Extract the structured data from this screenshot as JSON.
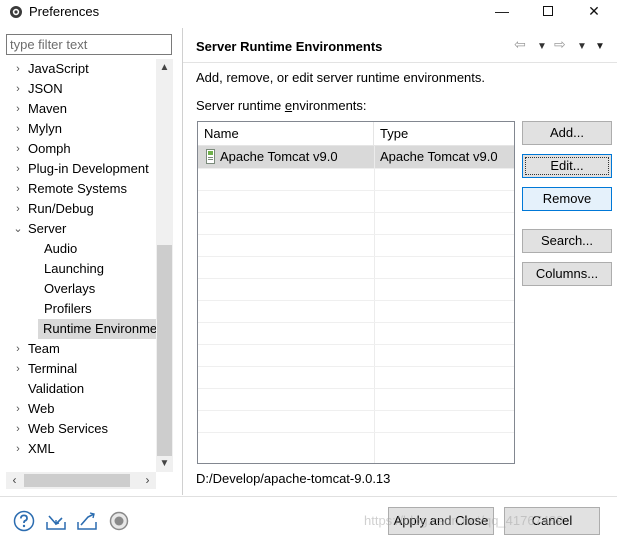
{
  "window": {
    "title": "Preferences",
    "controls": {
      "minimize": "—",
      "close": "✕"
    }
  },
  "sidebar": {
    "filter_placeholder": "type filter text",
    "items": [
      {
        "label": "JavaScript",
        "twisty": "›"
      },
      {
        "label": "JSON",
        "twisty": "›"
      },
      {
        "label": "Maven",
        "twisty": "›"
      },
      {
        "label": "Mylyn",
        "twisty": "›"
      },
      {
        "label": "Oomph",
        "twisty": "›"
      },
      {
        "label": "Plug-in Development",
        "twisty": "›"
      },
      {
        "label": "Remote Systems",
        "twisty": "›"
      },
      {
        "label": "Run/Debug",
        "twisty": "›"
      },
      {
        "label": "Server",
        "twisty": "⌄"
      },
      {
        "label": "Audio",
        "twisty": ""
      },
      {
        "label": "Launching",
        "twisty": ""
      },
      {
        "label": "Overlays",
        "twisty": ""
      },
      {
        "label": "Profilers",
        "twisty": ""
      },
      {
        "label": "Runtime Environme",
        "twisty": ""
      },
      {
        "label": "Team",
        "twisty": "›"
      },
      {
        "label": "Terminal",
        "twisty": "›"
      },
      {
        "label": "Validation",
        "twisty": ""
      },
      {
        "label": "Web",
        "twisty": "›"
      },
      {
        "label": "Web Services",
        "twisty": "›"
      },
      {
        "label": "XML",
        "twisty": "›"
      }
    ],
    "scroll_up": "▲",
    "scroll_down": "▼",
    "scroll_left": "‹",
    "scroll_right": "›"
  },
  "page": {
    "title": "Server Runtime Environments",
    "nav": {
      "back": "⇦",
      "forward": "⇨",
      "dropdown": "▼",
      "menu": "▼"
    },
    "description": "Add, remove, or edit server runtime environments.",
    "list_label_pre": "Server runtime ",
    "list_label_mnemonic": "e",
    "list_label_post": "nvironments:",
    "table": {
      "headers": {
        "name": "Name",
        "type": "Type"
      },
      "rows": [
        {
          "name": "Apache Tomcat v9.0",
          "type": "Apache Tomcat v9.0"
        }
      ]
    },
    "buttons": {
      "add": "Add...",
      "edit": "Edit...",
      "remove": "Remove",
      "search": "Search...",
      "columns": "Columns..."
    },
    "location_path": "D:/Develop/apache-tomcat-9.0.13"
  },
  "footer": {
    "apply_close": "Apply and Close",
    "cancel": "Cancel",
    "watermark": "https://blog.csdn.net/qq_41767489"
  }
}
